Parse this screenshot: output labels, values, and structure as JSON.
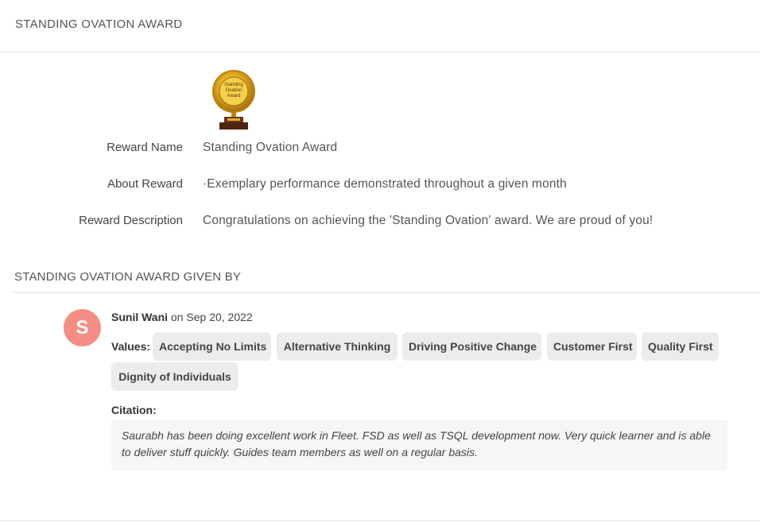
{
  "header": {
    "title": "STANDING OVATION AWARD"
  },
  "trophy": {
    "icon": "trophy-medal-icon",
    "badge_text": "Standing Ovation Award",
    "gold": "#d9a420",
    "base": "#5a2b12"
  },
  "reward": {
    "name_label": "Reward Name",
    "name_value": "Standing Ovation Award",
    "about_label": "About Reward",
    "about_value": "·Exemplary performance demonstrated throughout a given month",
    "description_label": "Reward Description",
    "description_value": "Congratulations on achieving the 'Standing Ovation' award. We are proud of you!"
  },
  "given_by": {
    "section_title": "STANDING OVATION AWARD GIVEN BY",
    "entry": {
      "avatar_letter": "S",
      "avatar_color": "#f48e85",
      "giver_name": "Sunil Wani",
      "date_text": " on Sep 20, 2022",
      "values_label": "Values:",
      "values": [
        "Accepting No Limits",
        "Alternative Thinking",
        "Driving Positive Change",
        "Customer First",
        "Quality First",
        "Dignity of Individuals"
      ],
      "citation_label": "Citation:",
      "citation_text": "Saurabh has been doing excellent work in Fleet. FSD as well as TSQL development now. Very quick learner and is able to deliver stuff quickly. Guides team members as well on a regular basis."
    }
  }
}
